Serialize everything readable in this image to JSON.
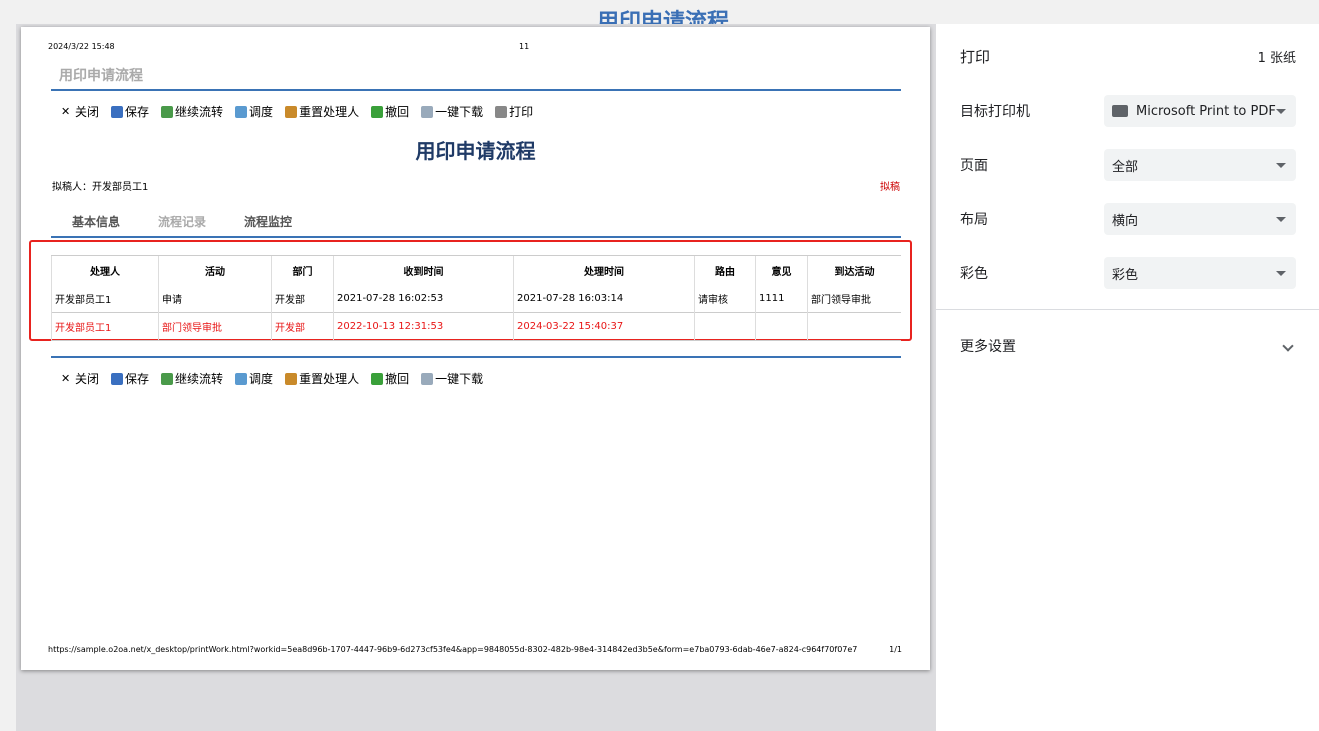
{
  "background_title": "用印申请流程",
  "page": {
    "header_date": "2024/3/22 15:48",
    "header_center": "11",
    "doc_title": "用印申请流程",
    "toolbar": [
      "关闭",
      "保存",
      "继续流转",
      "调度",
      "重置处理人",
      "撤回",
      "一键下载",
      "打印"
    ],
    "toolbar_bottom": [
      "关闭",
      "保存",
      "继续流转",
      "调度",
      "重置处理人",
      "撤回",
      "一键下载"
    ],
    "main_title": "用印申请流程",
    "drafter": "拟稿人：开发部员工1",
    "status": "拟稿",
    "tabs": [
      "基本信息",
      "流程记录",
      "流程监控"
    ],
    "table": {
      "headers": [
        "处理人",
        "活动",
        "部门",
        "收到时间",
        "处理时间",
        "路由",
        "意见",
        "到达活动"
      ],
      "rows": [
        [
          "开发部员工1",
          "申请",
          "开发部",
          "2021-07-28 16:02:53",
          "2021-07-28 16:03:14",
          "请审核",
          "1111",
          "部门领导审批"
        ],
        [
          "开发部员工1",
          "部门领导审批",
          "开发部",
          "2022-10-13 12:31:53",
          "2024-03-22 15:40:37",
          "",
          "",
          ""
        ]
      ]
    },
    "footer_url": "https://sample.o2oa.net/x_desktop/printWork.html?workid=5ea8d96b-1707-4447-96b9-6d273cf53fe4&app=9848055d-8302-482b-98e4-314842ed3b5e&form=e7ba0793-6dab-46e7-a824-c964f70f07e7",
    "footer_page": "1/1"
  },
  "panel": {
    "title": "打印",
    "sheets": "1 张纸",
    "printer_label": "目标打印机",
    "printer_value": "Microsoft Print to PDF",
    "pages_label": "页面",
    "pages_value": "全部",
    "layout_label": "布局",
    "layout_value": "横向",
    "color_label": "彩色",
    "color_value": "彩色",
    "more": "更多设置"
  }
}
